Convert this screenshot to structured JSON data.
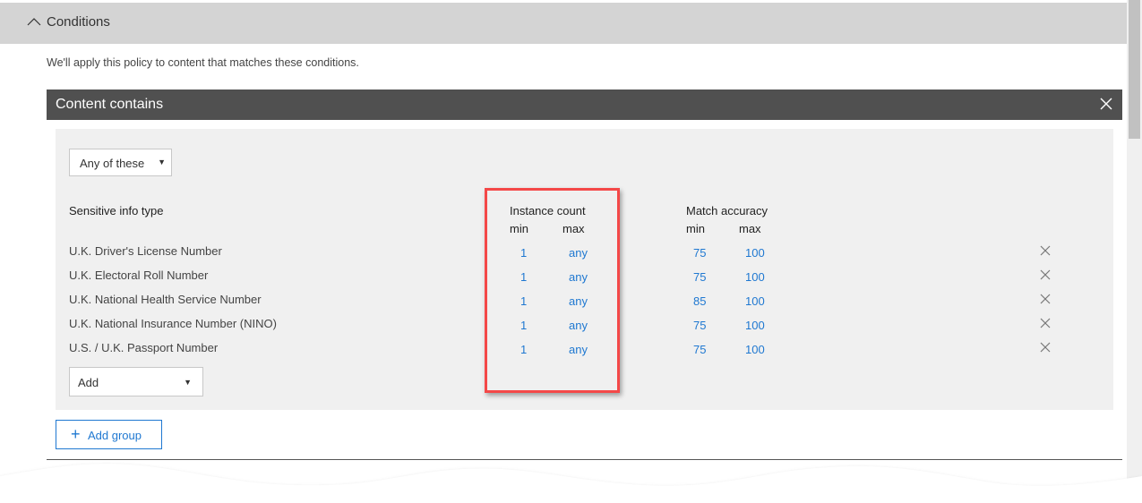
{
  "section": {
    "title": "Conditions",
    "collapse_icon": "chevron-up-icon",
    "intro": "We'll apply this policy to content that matches these conditions."
  },
  "content_contains": {
    "title": "Content contains",
    "close_icon": "close-icon",
    "match_mode": {
      "selected": "Any of these"
    },
    "columns": {
      "info_type": "Sensitive info type",
      "instance_count": "Instance count",
      "match_accuracy": "Match accuracy",
      "min": "min",
      "max": "max"
    },
    "rows": [
      {
        "name": "U.K. Driver's License Number",
        "instance_min": "1",
        "instance_max": "any",
        "accuracy_min": "75",
        "accuracy_max": "100"
      },
      {
        "name": "U.K. Electoral Roll Number",
        "instance_min": "1",
        "instance_max": "any",
        "accuracy_min": "75",
        "accuracy_max": "100"
      },
      {
        "name": "U.K. National Health Service Number",
        "instance_min": "1",
        "instance_max": "any",
        "accuracy_min": "85",
        "accuracy_max": "100"
      },
      {
        "name": "U.K. National Insurance Number (NINO)",
        "instance_min": "1",
        "instance_max": "any",
        "accuracy_min": "75",
        "accuracy_max": "100"
      },
      {
        "name": "U.S. / U.K. Passport Number",
        "instance_min": "1",
        "instance_max": "any",
        "accuracy_min": "75",
        "accuracy_max": "100"
      }
    ],
    "add_select": {
      "label": "Add"
    }
  },
  "add_group": {
    "label": "Add group",
    "icon": "plus-icon"
  },
  "colors": {
    "link": "#1f78d1",
    "highlight": "#f44848",
    "header_dark": "#505050",
    "section_bg": "#d4d4d4",
    "panel_bg": "#f0f0f0"
  }
}
